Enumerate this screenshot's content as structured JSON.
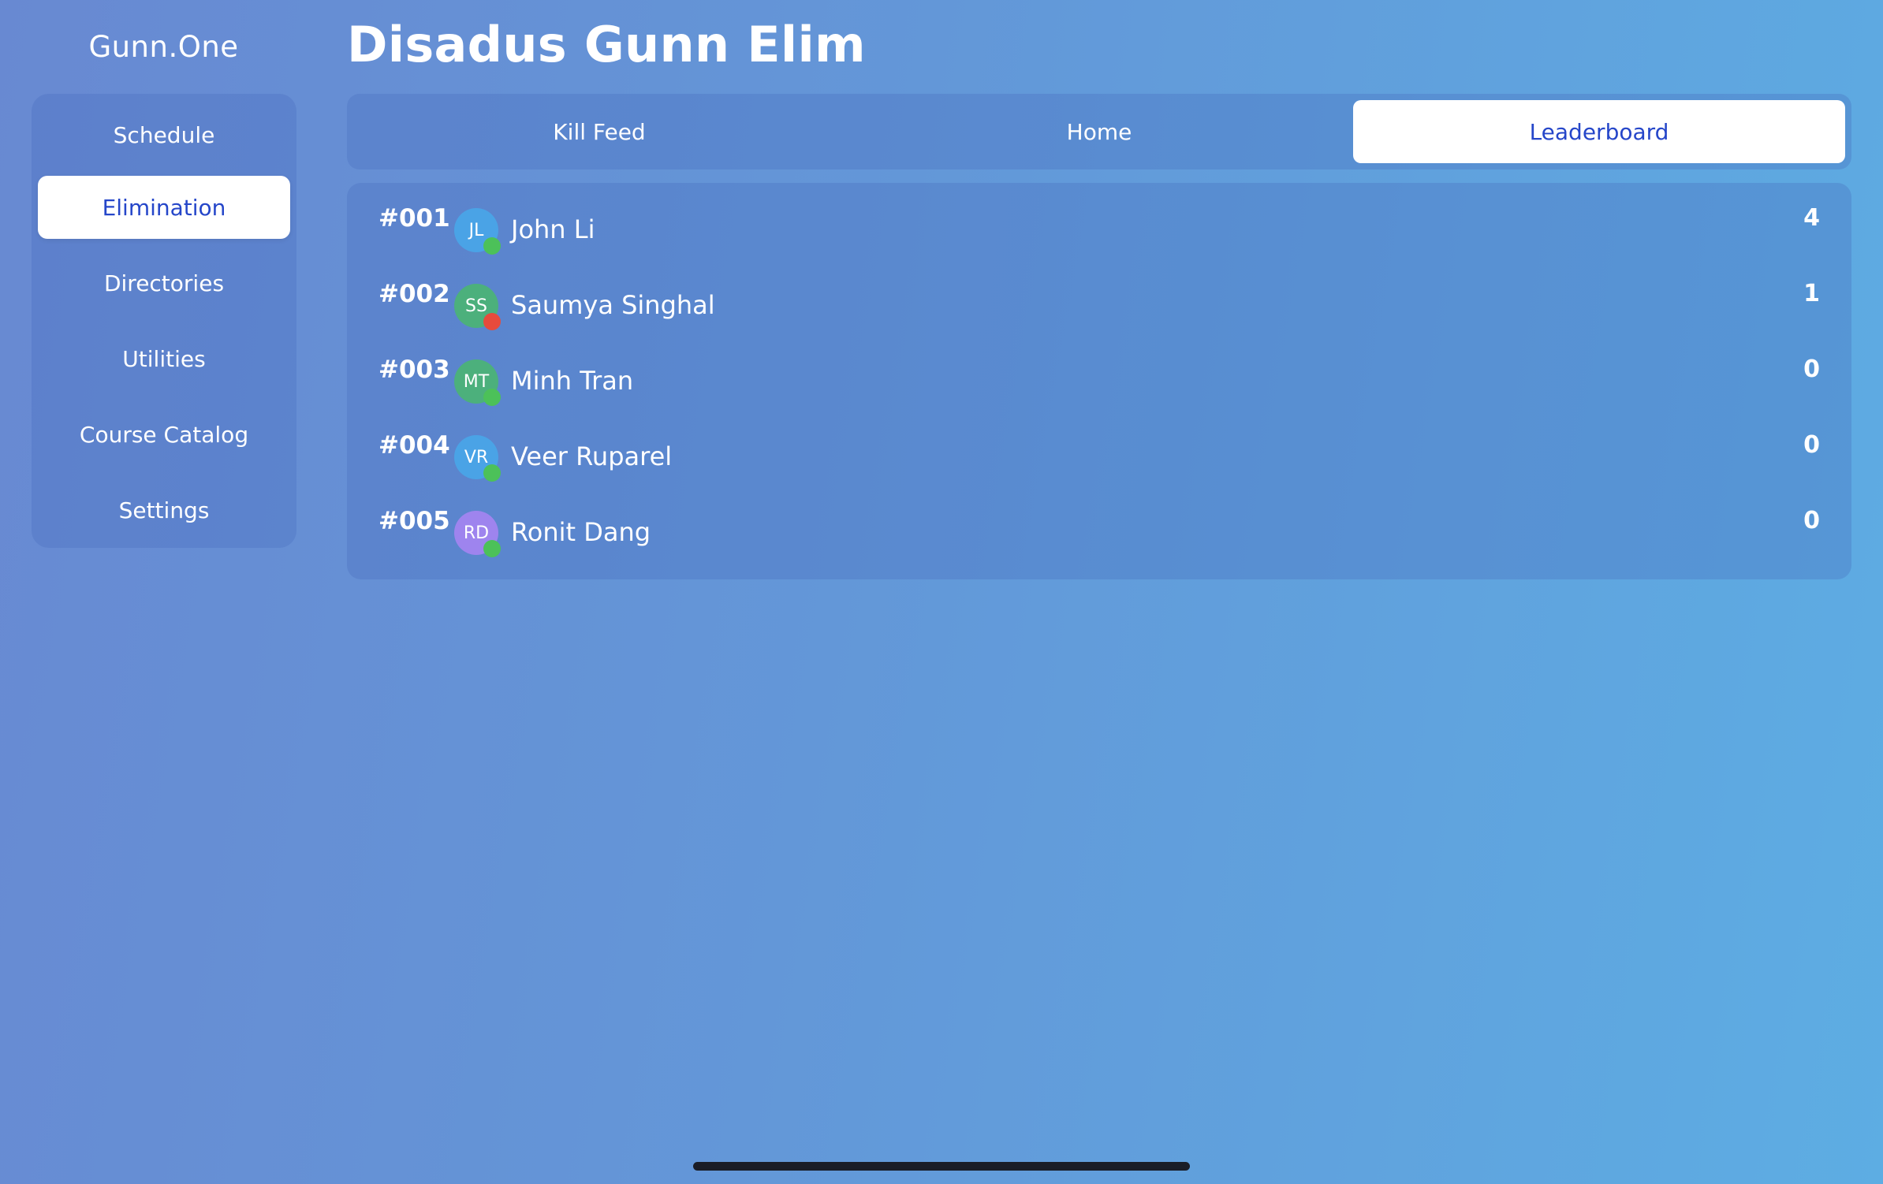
{
  "app_title": "Gunn.One",
  "page_title": "Disadus Gunn Elim",
  "sidebar": {
    "items": [
      {
        "label": "Schedule",
        "active": false
      },
      {
        "label": "Elimination",
        "active": true
      },
      {
        "label": "Directories",
        "active": false
      },
      {
        "label": "Utilities",
        "active": false
      },
      {
        "label": "Course Catalog",
        "active": false
      },
      {
        "label": "Settings",
        "active": false
      }
    ]
  },
  "tabs": [
    {
      "label": "Kill Feed",
      "active": false
    },
    {
      "label": "Home",
      "active": false
    },
    {
      "label": "Leaderboard",
      "active": true
    }
  ],
  "leaderboard": [
    {
      "rank": "#001",
      "initials": "JL",
      "name": "John Li",
      "score": "4",
      "avatar_color": "#4aa3e6",
      "status_color": "#4cc159"
    },
    {
      "rank": "#002",
      "initials": "SS",
      "name": "Saumya Singhal",
      "score": "1",
      "avatar_color": "#4cb07c",
      "status_color": "#e74b3c"
    },
    {
      "rank": "#003",
      "initials": "MT",
      "name": "Minh Tran",
      "score": "0",
      "avatar_color": "#4cb07c",
      "status_color": "#4cc159"
    },
    {
      "rank": "#004",
      "initials": "VR",
      "name": "Veer Ruparel",
      "score": "0",
      "avatar_color": "#4aa3e6",
      "status_color": "#4cc159"
    },
    {
      "rank": "#005",
      "initials": "RD",
      "name": "Ronit Dang",
      "score": "0",
      "avatar_color": "#9e84ee",
      "status_color": "#4cc159"
    }
  ],
  "colors": {
    "accent": "#2546c9",
    "status_alive": "#4cc159",
    "status_eliminated": "#e74b3c"
  }
}
